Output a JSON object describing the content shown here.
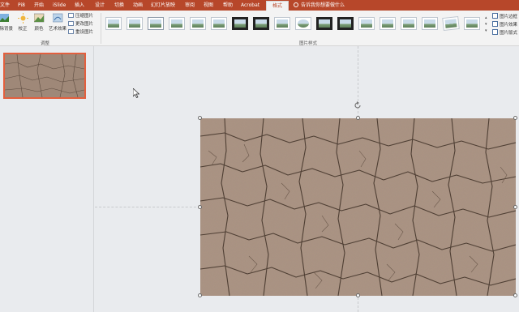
{
  "tabs": [
    {
      "label": "文件",
      "active": false
    },
    {
      "label": "Pi8",
      "active": false
    },
    {
      "label": "开始",
      "active": false
    },
    {
      "label": "iSlide",
      "active": false
    },
    {
      "label": "插入",
      "active": false
    },
    {
      "label": "设计",
      "active": false
    },
    {
      "label": "切换",
      "active": false
    },
    {
      "label": "动画",
      "active": false
    },
    {
      "label": "幻灯片放映",
      "active": false
    },
    {
      "label": "审阅",
      "active": false
    },
    {
      "label": "视图",
      "active": false
    },
    {
      "label": "帮助",
      "active": false
    },
    {
      "label": "Acrobat",
      "active": false
    },
    {
      "label": "格式",
      "active": true
    }
  ],
  "search": {
    "text": "告诉我你想要做什么"
  },
  "ribbon": {
    "adjust": {
      "remove_bg": "删除背景",
      "corrections": "校正",
      "color": "颜色",
      "artistic": "艺术效果",
      "compress": "压缩图片",
      "change": "更改图片",
      "reset": "重设图片",
      "group_label": "调整"
    },
    "styles": {
      "group_label": "图片样式",
      "border": "图片边框",
      "effects": "图片效果",
      "layout": "图片版式"
    }
  },
  "colors": {
    "accent": "#b7472a",
    "selection": "#e35f3e",
    "texture": "#a89080"
  },
  "icons": [
    "remove-bg-icon",
    "corrections-icon",
    "color-icon",
    "artistic-effects-icon",
    "compress-icon",
    "change-picture-icon",
    "reset-picture-icon",
    "rotate-handle-icon",
    "mouse-cursor-icon",
    "search-icon"
  ]
}
